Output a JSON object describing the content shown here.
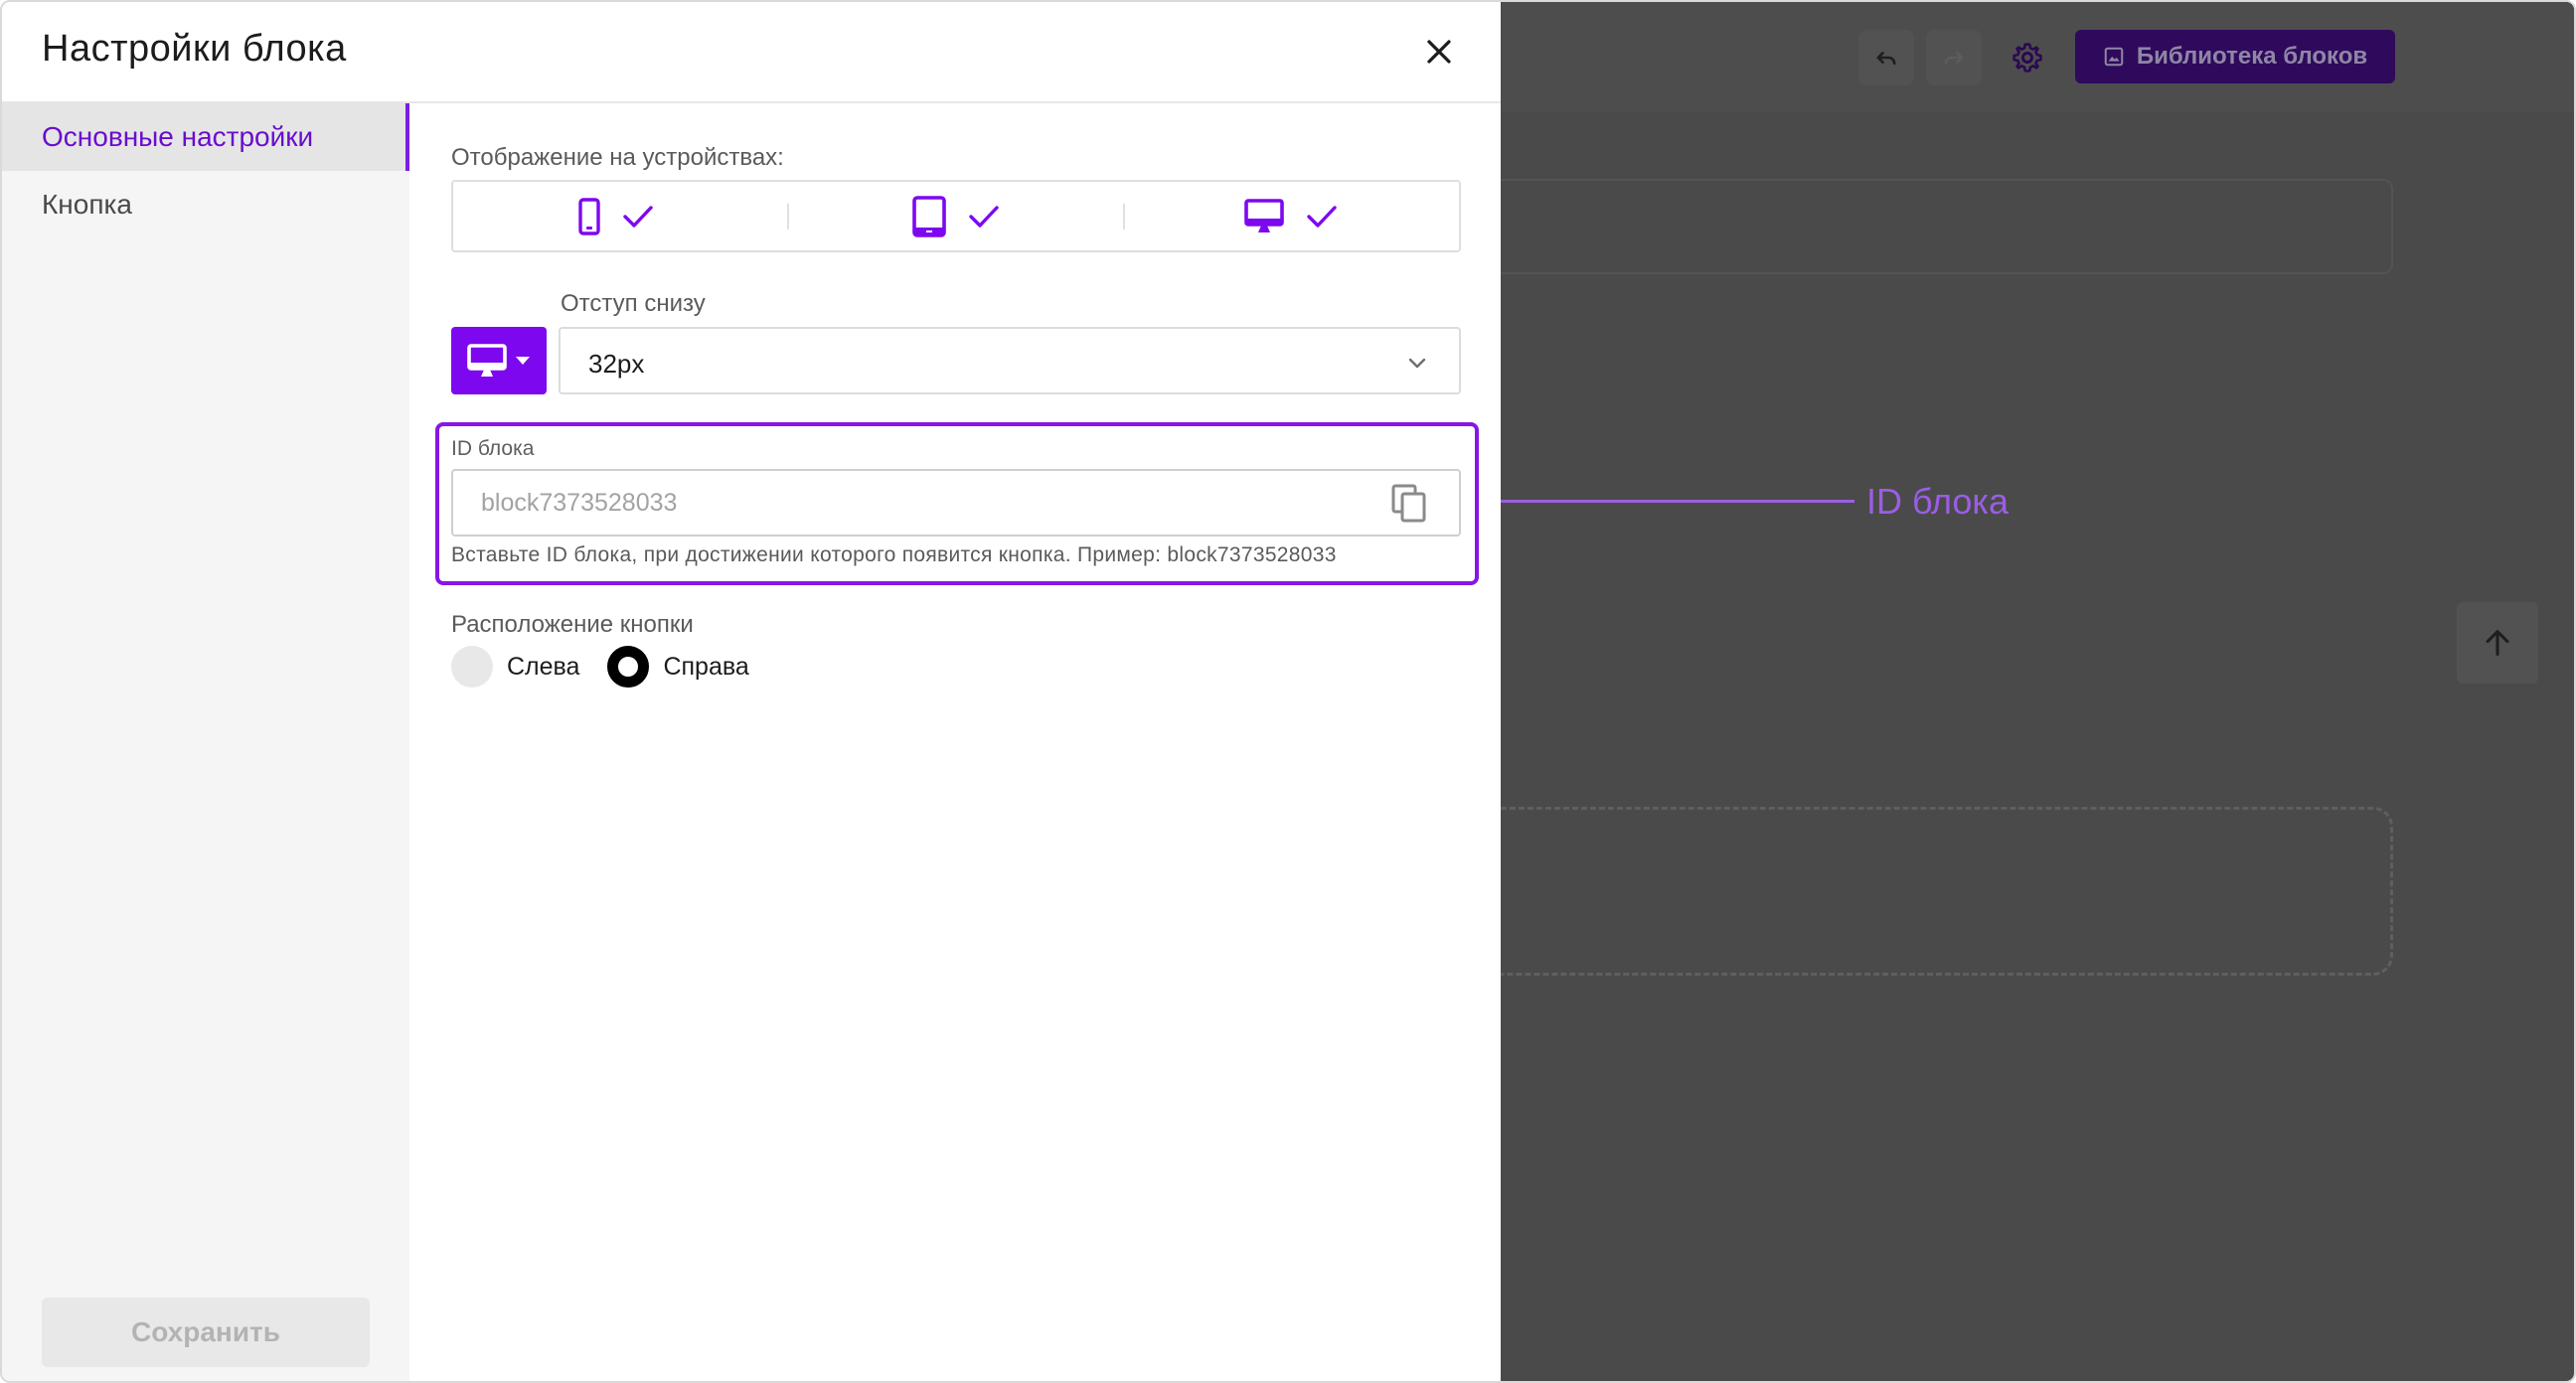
{
  "dialog": {
    "title": "Настройки блока",
    "sidebar": {
      "items": [
        {
          "label": "Основные настройки",
          "active": true
        },
        {
          "label": "Кнопка",
          "active": false
        }
      ],
      "save_label": "Сохранить"
    },
    "devices": {
      "label": "Отображение на устройствах:",
      "items": [
        {
          "icon": "mobile-icon",
          "checked": true
        },
        {
          "icon": "tablet-icon",
          "checked": true
        },
        {
          "icon": "desktop-icon",
          "checked": true
        }
      ]
    },
    "bottom_margin": {
      "label": "Отступ снизу",
      "device": "desktop-icon",
      "value": "32px"
    },
    "block_id": {
      "label": "ID блока",
      "placeholder": "block7373528033",
      "value": "",
      "hint": "Вставьте ID блока, при достижении которого появится кнопка. Пример: block7373528033"
    },
    "button_position": {
      "label": "Расположение кнопки",
      "options": [
        {
          "label": "Слева",
          "selected": false
        },
        {
          "label": "Справа",
          "selected": true
        }
      ]
    }
  },
  "editor": {
    "library_label": "Библиотека блоков",
    "toolbar_icons": [
      "undo-icon",
      "redo-icon",
      "gear-icon",
      "image-icon"
    ],
    "scroll_icon": "arrow-up-icon"
  },
  "annotation": {
    "label": "ID блока",
    "color": "#9b5de5"
  },
  "colors": {
    "accent": "#7d08f0",
    "highlight_border": "#8617e6",
    "active_nav_text": "#6a0dce",
    "overlay": "#4a4a4a"
  }
}
